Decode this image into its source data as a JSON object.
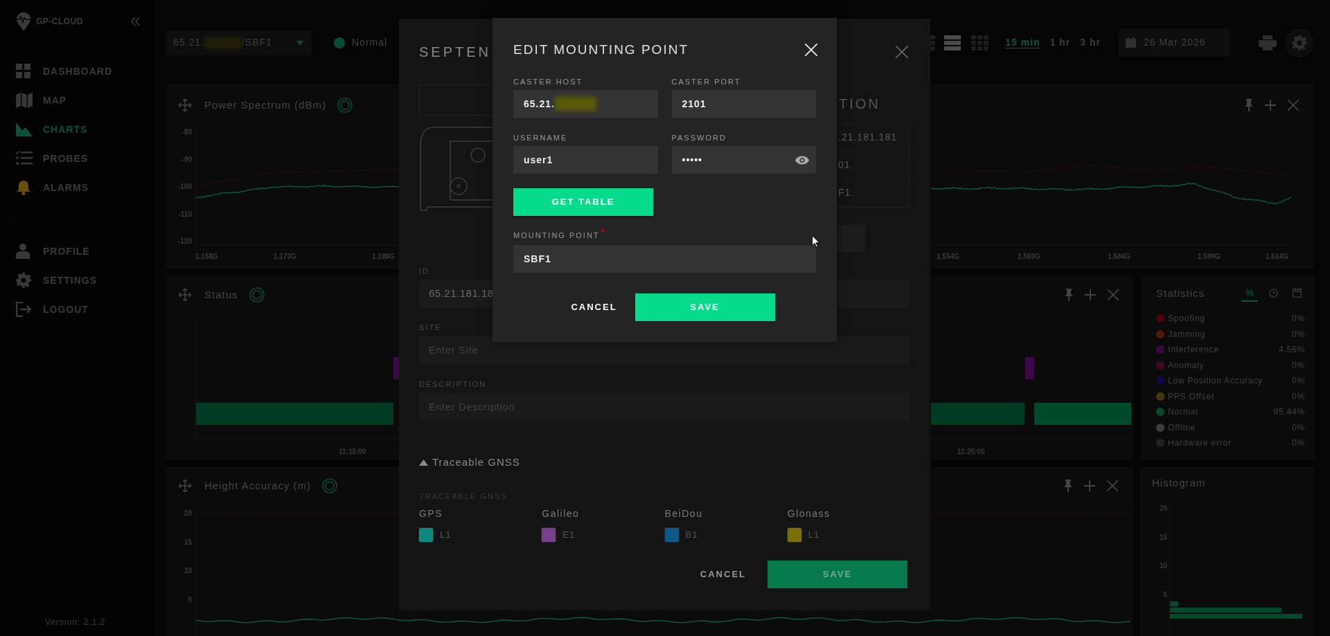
{
  "sidebar": {
    "brand": "GP-CLOUD",
    "nav": [
      {
        "kind": "dashboard",
        "label": "DASHBOARD",
        "selected": false
      },
      {
        "kind": "map",
        "label": "MAP",
        "selected": false
      },
      {
        "kind": "charts",
        "label": "CHARTS",
        "selected": true
      },
      {
        "kind": "probes",
        "label": "PROBES",
        "selected": false
      },
      {
        "kind": "alarms",
        "label": "ALARMS",
        "selected": false
      }
    ],
    "bottom_nav": [
      {
        "kind": "profile",
        "label": "PROFILE"
      },
      {
        "kind": "settings",
        "label": "SETTINGS"
      },
      {
        "kind": "logout",
        "label": "LOGOUT"
      }
    ],
    "version": "Version: 2.1.2"
  },
  "topbar": {
    "probe": {
      "prefix": "65.21.",
      "redacted": true,
      "suffix": "/SBF1"
    },
    "status": {
      "label": "Normal",
      "color": "#0b4d33"
    },
    "layouts": [
      {
        "kind": "tiles",
        "selected": false
      },
      {
        "kind": "rows",
        "selected": true
      },
      {
        "kind": "grid",
        "selected": false
      }
    ],
    "ranges": [
      {
        "label": "15 min",
        "selected": true
      },
      {
        "label": "1 hr",
        "selected": false
      },
      {
        "label": "3 hr",
        "selected": false
      }
    ],
    "date": "26 Mar 2026"
  },
  "power_spectrum": {
    "title": "Power Spectrum (dBm)",
    "y_ticks": [
      "-80",
      "-90",
      "-100",
      "-110",
      "-120"
    ],
    "x_labels_left": [
      "1.158G",
      "1.173G",
      "1.188G"
    ],
    "x_labels_right": [
      "1.554G",
      "1.569G",
      "1.584G",
      "1.599G",
      "1.614G"
    ]
  },
  "status_panel": {
    "title": "Status",
    "time_labels": [
      "11:15:00",
      "11:25:00"
    ]
  },
  "statistics": {
    "title": "Statistics",
    "tabs": [
      {
        "kind": "percent",
        "label": "%",
        "selected": true
      },
      {
        "kind": "clock",
        "selected": false
      },
      {
        "kind": "calendar",
        "selected": false
      }
    ],
    "items": [
      {
        "name": "Spoofing",
        "value": "0%",
        "color": "#4a0404"
      },
      {
        "name": "Jamming",
        "value": "0%",
        "color": "#4a1b08"
      },
      {
        "name": "Interference",
        "value": "4.56%",
        "color": "#3c0848"
      },
      {
        "name": "Anomaly",
        "value": "0%",
        "color": "#420624"
      },
      {
        "name": "Low Position Accuracy",
        "value": "0%",
        "color": "#0b0b4a"
      },
      {
        "name": "PPS Offset",
        "value": "0%",
        "color": "#4a3806"
      },
      {
        "name": "Normal",
        "value": "95.44%",
        "color": "#034a2c"
      },
      {
        "name": "Offline",
        "value": "0%",
        "color": "#3c3c3c"
      },
      {
        "name": "Hardware error",
        "value": "0%",
        "color": "#222222"
      }
    ]
  },
  "height_panel": {
    "title": "Height Accuracy (m)",
    "y_ticks": [
      "20",
      "15",
      "10",
      "5"
    ]
  },
  "histogram": {
    "title": "Histogram",
    "y_ticks": [
      "20",
      "15",
      "10",
      "5"
    ]
  },
  "probe_dialog": {
    "title": "SEPTEN",
    "info_heading": "TION",
    "info_rows": [
      ".21.181.181",
      "01",
      "F1"
    ],
    "id": {
      "label": "ID",
      "value": "65.21.181.18"
    },
    "site": {
      "label": "SITE",
      "placeholder": "Enter Site"
    },
    "description": {
      "label": "DESCRIPTION",
      "placeholder": "Enter Description"
    },
    "gnss_section": {
      "label": "Traceable GNSS",
      "expanded": true
    },
    "gnss_label": "TRACEABLE GNSS",
    "constellations": [
      {
        "name": "GPS",
        "band": "L1",
        "checked": true,
        "color": "#0b8a80"
      },
      {
        "name": "Galileo",
        "band": "E1",
        "checked": true,
        "color": "#7a3f8c"
      },
      {
        "name": "BeiDou",
        "band": "B1",
        "checked": true,
        "color": "#0b5a8a"
      },
      {
        "name": "Glonass",
        "band": "L1",
        "checked": true,
        "color": "#7a7000"
      }
    ],
    "cancel": "CANCEL",
    "save": "SAVE"
  },
  "mount_dialog": {
    "title": "EDIT MOUNTING POINT",
    "fields": [
      {
        "kind": "host",
        "label": "CASTER HOST",
        "value": "65.21.",
        "redacted": true
      },
      {
        "kind": "text",
        "label": "CASTER PORT",
        "value": "2101"
      },
      {
        "kind": "text",
        "label": "USERNAME",
        "value": "user1"
      },
      {
        "kind": "password",
        "label": "PASSWORD",
        "value": "•••••"
      }
    ],
    "get_table": "GET TABLE",
    "mounting_point": {
      "label": "MOUNTING POINT",
      "value": "SBF1",
      "required": true
    },
    "cancel": "CANCEL",
    "save": "SAVE"
  }
}
